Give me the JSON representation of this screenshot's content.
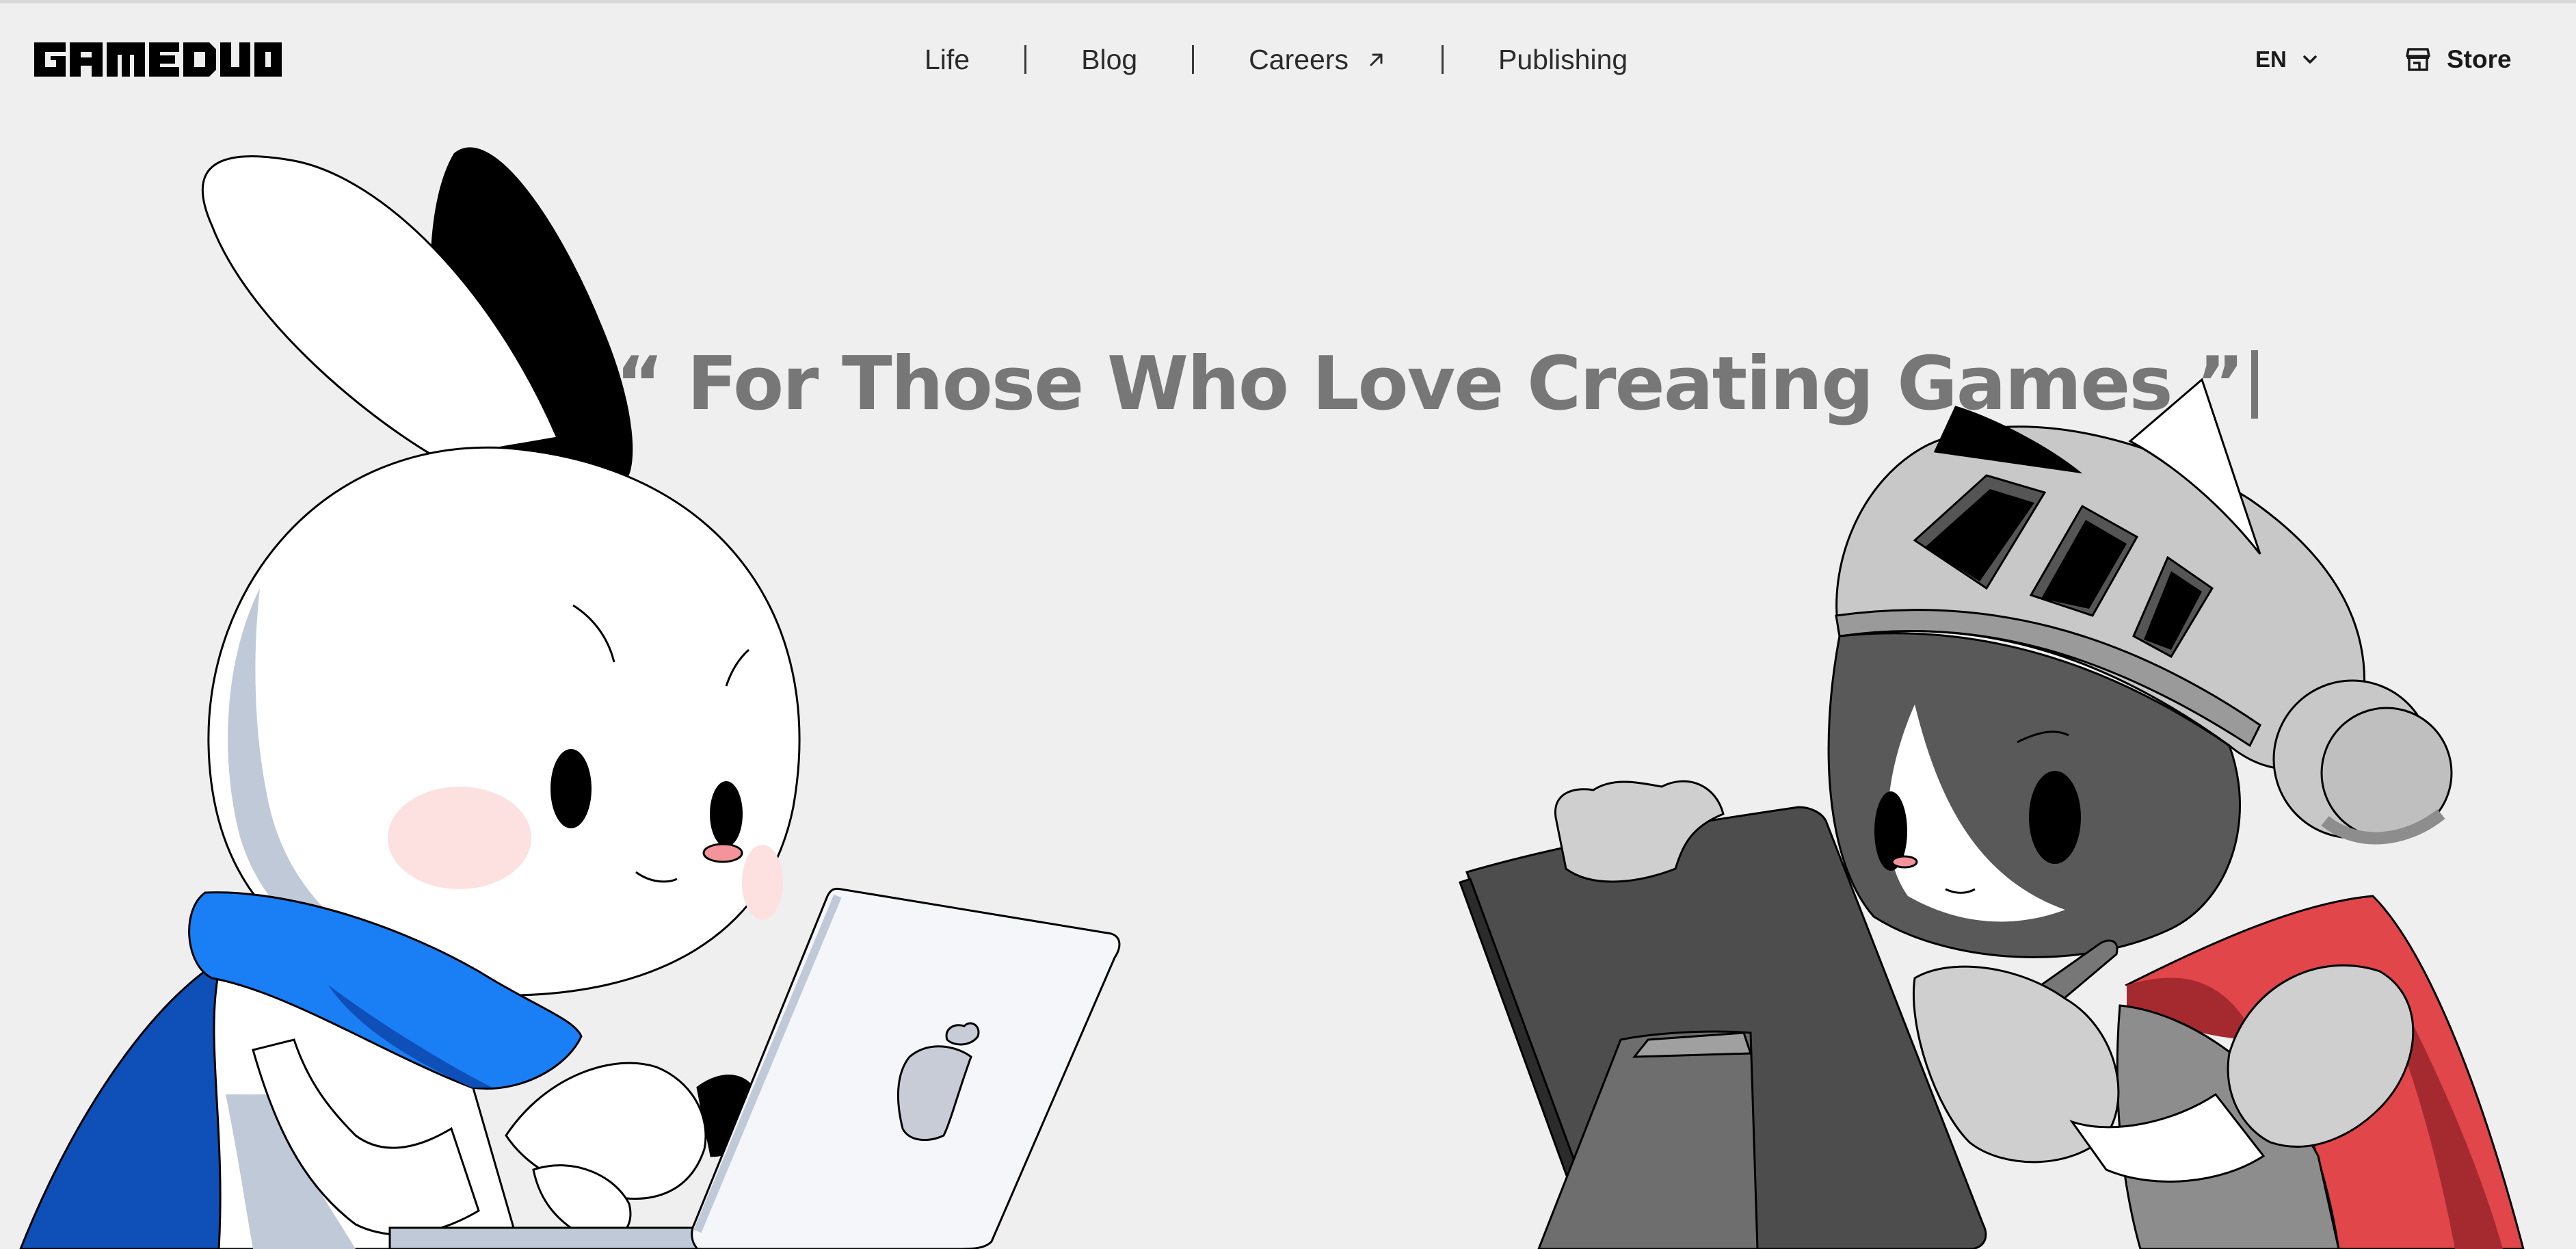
{
  "brand": {
    "logo_text": "GAMEDUO"
  },
  "nav": {
    "items": [
      {
        "label": "Life"
      },
      {
        "label": "Blog"
      },
      {
        "label": "Careers",
        "icon": "external-arrow-icon"
      },
      {
        "label": "Publishing"
      }
    ]
  },
  "language": {
    "selected": "EN",
    "icon": "chevron-down-icon"
  },
  "store": {
    "label": "Store",
    "icon": "store-icon"
  },
  "hero": {
    "title": "“ For Those Who Love Creating Games ”"
  },
  "illustration": {
    "left_character": "rabbit-character-with-laptop",
    "right_character": "knight-cat-character-with-tablet"
  },
  "colors": {
    "background": "#efefef",
    "title": "#777777",
    "scarf_blue": "#1a7ef5",
    "scarf_red": "#e0464a"
  }
}
